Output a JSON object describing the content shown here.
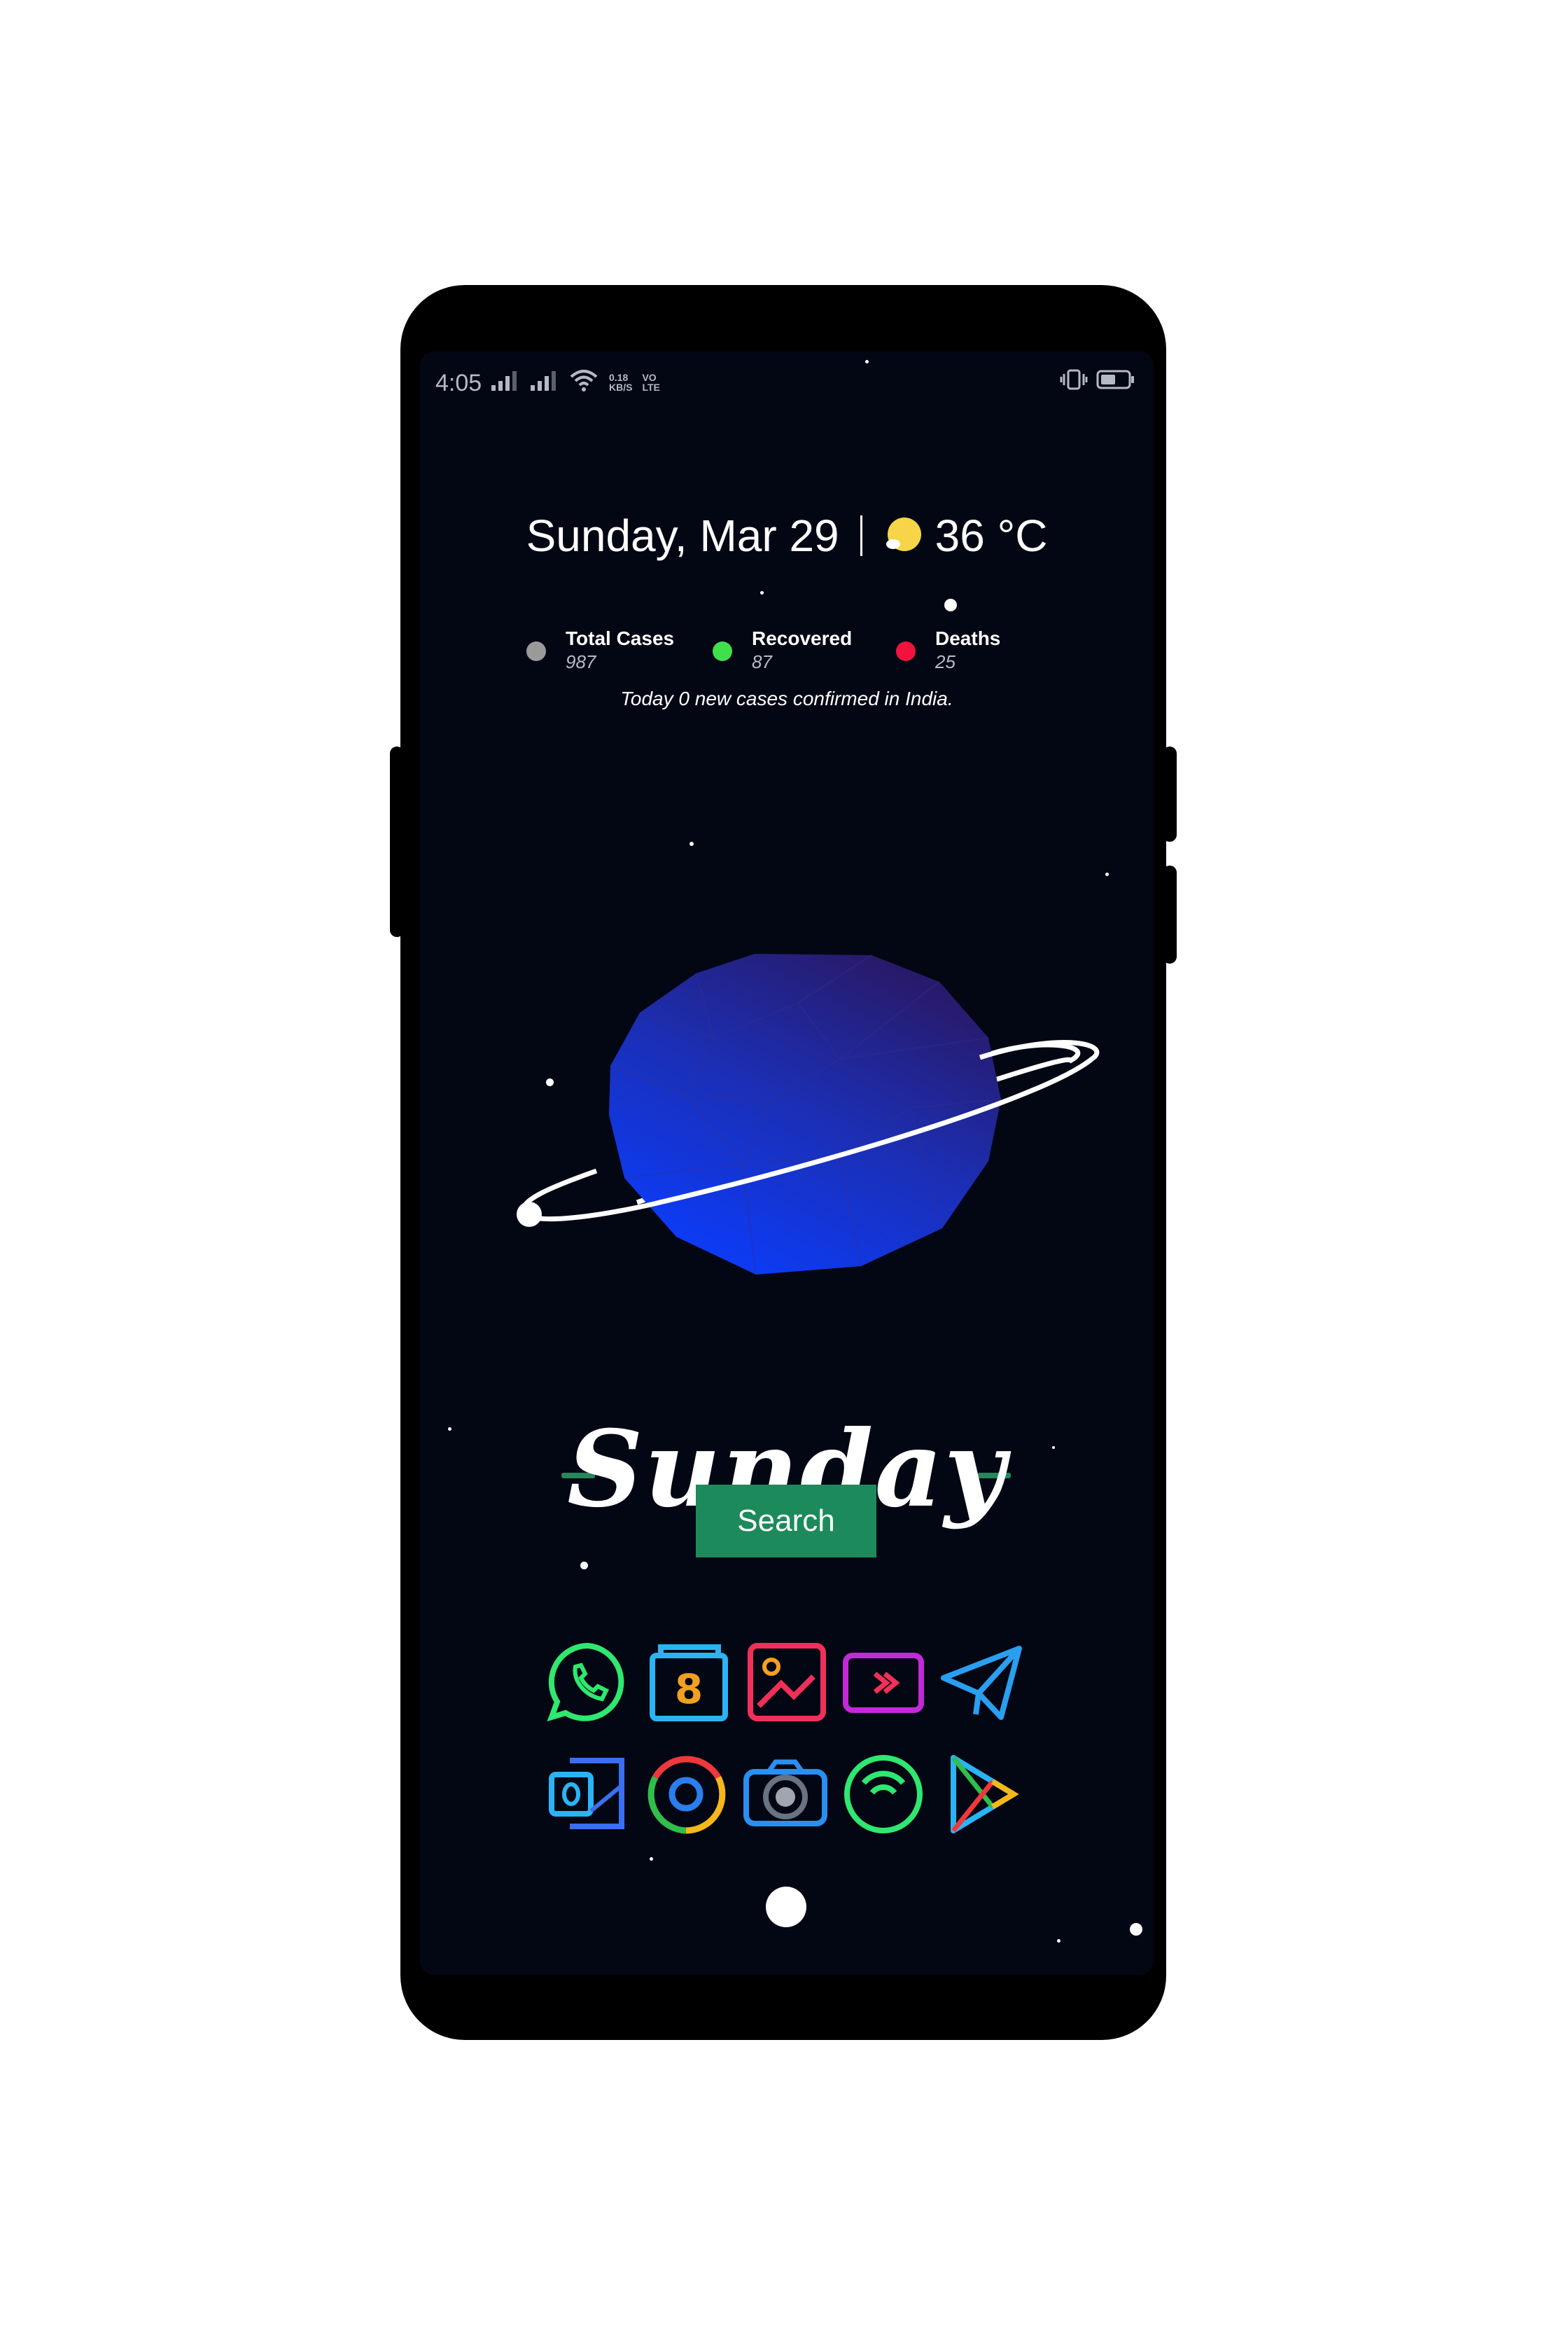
{
  "status_bar": {
    "time": "4:05",
    "net_speed_top": "0.18",
    "net_speed_bottom": "KB/S",
    "volte_top": "VO",
    "volte_bottom": "LTE"
  },
  "widget": {
    "date": "Sunday, Mar 29",
    "temperature": "36 °C",
    "weather_icon": "sun-icon"
  },
  "covid": {
    "items": [
      {
        "label": "Total Cases",
        "value": "987",
        "color": "#9a9a9a"
      },
      {
        "label": "Recovered",
        "value": "87",
        "color": "#3ee04b"
      },
      {
        "label": "Deaths",
        "value": "25",
        "color": "#f0133d"
      }
    ],
    "note": "Today 0 new cases confirmed in India."
  },
  "day_banner": "Sunday",
  "search_label": "Search",
  "apps_row1": [
    "whatsapp-icon",
    "wallet-icon",
    "gallery-icon",
    "video-player-icon",
    "telegram-icon"
  ],
  "apps_row2": [
    "outlook-icon",
    "chrome-icon",
    "camera-icon",
    "hotspot-icon",
    "play-store-icon"
  ],
  "colors": {
    "screen_bg": "#030714",
    "accent_green": "#1c8a5a",
    "planet_blue": "#1f3bd8"
  }
}
